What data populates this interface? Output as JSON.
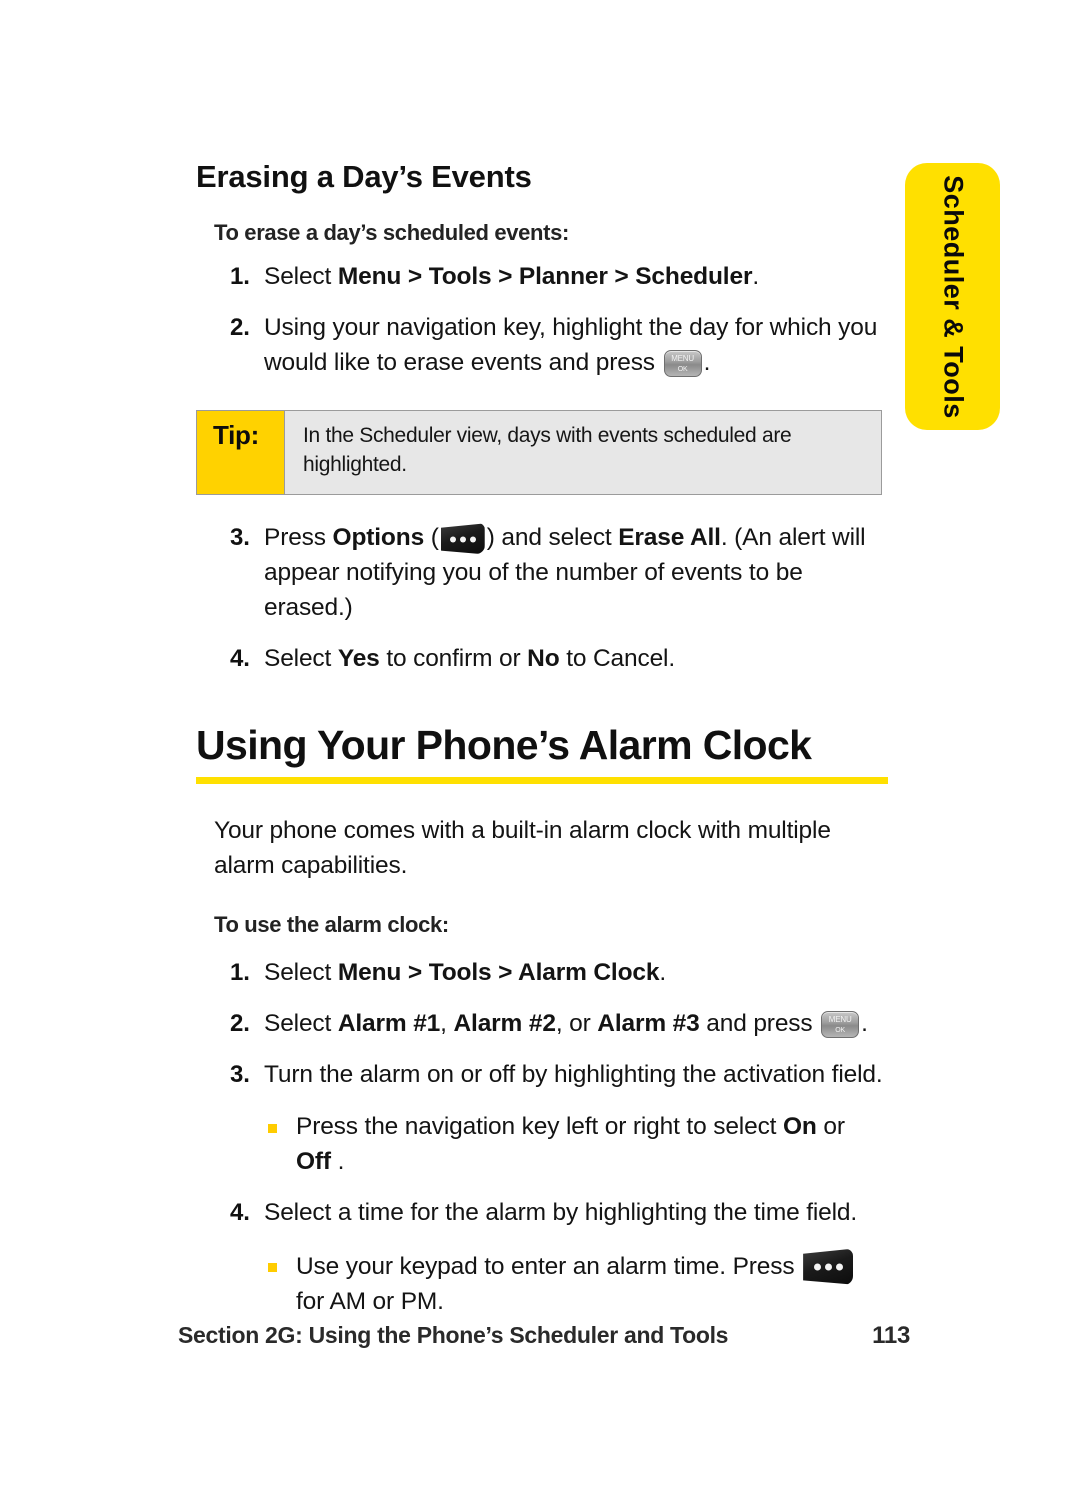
{
  "side_tab": {
    "label": "Scheduler & Tools",
    "color": "#FFE000"
  },
  "section_one": {
    "heading": "Erasing a Day’s Events",
    "lead_in": "To erase a day’s scheduled events:",
    "steps": [
      {
        "num": "1.",
        "parts": [
          {
            "t": "Select "
          },
          {
            "t": "Menu > Tools > Planner > Scheduler",
            "b": true
          },
          {
            "t": "."
          }
        ]
      },
      {
        "num": "2.",
        "parts": [
          {
            "t": "Using your navigation key, highlight the day for which you would like to erase events and press "
          },
          {
            "icon": "menu-ok-key"
          },
          {
            "t": "."
          }
        ]
      },
      {
        "num": "3.",
        "parts": [
          {
            "t": "Press "
          },
          {
            "t": "Options",
            "b": true
          },
          {
            "t": " ("
          },
          {
            "icon": "options-key"
          },
          {
            "t": ") and select "
          },
          {
            "t": "Erase All",
            "b": true
          },
          {
            "t": ". (An alert will appear notifying you of the number of events to be erased.)"
          }
        ]
      },
      {
        "num": "4.",
        "parts": [
          {
            "t": "Select "
          },
          {
            "t": "Yes",
            "b": true
          },
          {
            "t": " to confirm or "
          },
          {
            "t": "No",
            "b": true
          },
          {
            "t": " to Cancel."
          }
        ]
      }
    ],
    "tip": {
      "label": "Tip:",
      "text": "In the Scheduler view, days with events scheduled are highlighted.",
      "label_color": "#FFD200",
      "body_color": "#E7E7E7"
    }
  },
  "section_two": {
    "heading": "Using Your Phone’s Alarm Clock",
    "rule_color": "#FFE000",
    "intro": "Your phone comes with a built-in alarm clock with multiple alarm capabilities.",
    "lead_in": "To use the alarm clock:",
    "steps": [
      {
        "num": "1.",
        "parts": [
          {
            "t": "Select "
          },
          {
            "t": "Menu > Tools > Alarm Clock",
            "b": true
          },
          {
            "t": "."
          }
        ]
      },
      {
        "num": "2.",
        "parts": [
          {
            "t": "Select "
          },
          {
            "t": "Alarm #1",
            "b": true
          },
          {
            "t": ", "
          },
          {
            "t": "Alarm #2",
            "b": true
          },
          {
            "t": ", or "
          },
          {
            "t": "Alarm #3",
            "b": true
          },
          {
            "t": " and press "
          },
          {
            "icon": "menu-ok-key"
          },
          {
            "t": "."
          }
        ]
      },
      {
        "num": "3.",
        "parts": [
          {
            "t": "Turn the alarm on or off by highlighting the activation field."
          }
        ],
        "bullets": [
          {
            "parts": [
              {
                "t": "Press the navigation key left or right to select "
              },
              {
                "t": "On",
                "b": true
              },
              {
                "t": " or "
              },
              {
                "t": "Off",
                "b": true
              },
              {
                "t": " ."
              }
            ]
          }
        ]
      },
      {
        "num": "4.",
        "parts": [
          {
            "t": "Select a time for the alarm by highlighting the time field."
          }
        ],
        "bullets": [
          {
            "parts": [
              {
                "t": "Use your keypad to enter an alarm time. Press "
              },
              {
                "icon": "options-key-big"
              },
              {
                "t": " for AM or PM."
              }
            ]
          }
        ]
      }
    ]
  },
  "footer": {
    "section_label": "Section 2G: Using the Phone’s Scheduler and Tools",
    "page_number": "113"
  },
  "icons": {
    "menu_ok_key": {
      "line1": "MENU",
      "line2": "OK"
    },
    "options_key": {
      "dots": 3
    }
  }
}
